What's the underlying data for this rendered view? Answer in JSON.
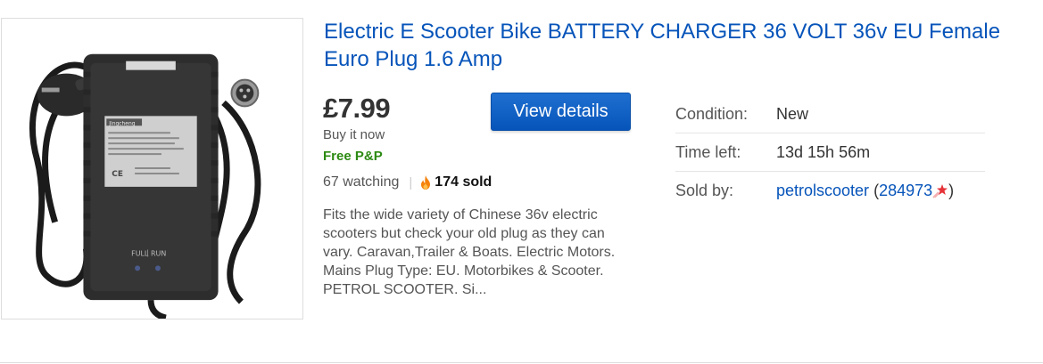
{
  "listing": {
    "title": "Electric E Scooter Bike BATTERY CHARGER 36 VOLT 36v EU Female Euro Plug 1.6 Amp",
    "price": "£7.99",
    "buy_format": "Buy it now",
    "shipping": "Free P&P",
    "watching": "67 watching",
    "separator": "|",
    "sold": "174 sold",
    "view_button_label": "View details",
    "description": "Fits the wide variety of Chinese 36v electric scooters but check your old plug as they can vary. Caravan,Trailer & Boats. Electric Motors. Mains Plug Type: EU. Motorbikes & Scooter. PETROL SCOOTER. Si..."
  },
  "details": {
    "condition_label": "Condition:",
    "condition_value": "New",
    "time_left_label": "Time left:",
    "time_left_value": "13d 15h 56m",
    "seller_label": "Sold by:",
    "seller_name": "petrolscooter",
    "open_paren": " (",
    "feedback_score": "284973",
    "close_paren": ")"
  },
  "image": {
    "brand_text": "Jingcheng",
    "label_full": "FULL",
    "label_run": "RUN",
    "label_ce": "CE"
  },
  "icons": {
    "flame": "flame-icon",
    "star": "shooting-star-icon"
  },
  "colors": {
    "link": "#0654ba",
    "free_shipping": "#2c8a12",
    "button": "#0654ba",
    "flame": "#f5820b",
    "star": "#e53238"
  }
}
